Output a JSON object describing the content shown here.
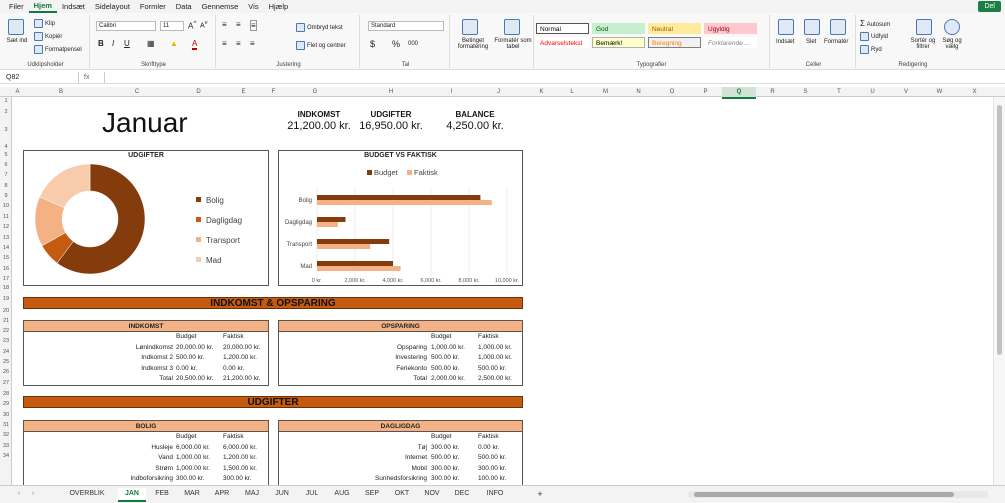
{
  "menu": {
    "items": [
      "Filer",
      "Hjem",
      "Indsæt",
      "Sidelayout",
      "Formler",
      "Data",
      "Gennemse",
      "Vis",
      "Hjælp"
    ],
    "active": "Hjem",
    "share_label": "Del"
  },
  "ribbon": {
    "clipboard": {
      "paste": "Sæt ind",
      "cut": "Klip",
      "copy": "Kopiér",
      "format_painter": "Formatpensel",
      "label": "Udklipsholder"
    },
    "font": {
      "name": "Calibri",
      "size": "11",
      "label": "Skrifttype"
    },
    "alignment": {
      "wrap": "Ombryd tekst",
      "merge": "Flet og centrer",
      "label": "Justering"
    },
    "number": {
      "format": "Standard",
      "label": "Tal"
    },
    "conditional": "Betinget formatering",
    "format_table": "Formatér som tabel",
    "styles": {
      "label": "Typografier",
      "items": [
        "Normal",
        "God",
        "Neutral",
        "Ugyldig",
        "Advarselstekst",
        "Bemærk!",
        "Beregning",
        "Forklarende ..."
      ]
    },
    "cells": {
      "insert": "Indsæt",
      "delete": "Slet",
      "format": "Formatér",
      "label": "Celler"
    },
    "editing": {
      "autosum": "Autosum",
      "fill": "Udfyld",
      "clear": "Ryd",
      "sort": "Sortér og filtrer",
      "find": "Søg og vælg",
      "label": "Redigering"
    }
  },
  "formula_bar": {
    "name_box": "Q82",
    "fx": "fx",
    "value": ""
  },
  "columns": [
    "A",
    "B",
    "C",
    "D",
    "E",
    "F",
    "G",
    "H",
    "I",
    "J",
    "K",
    "L",
    "M",
    "N",
    "O",
    "P",
    "Q",
    "R",
    "S",
    "T",
    "U",
    "V",
    "W",
    "X"
  ],
  "selected_column": "Q",
  "rows": [
    "1",
    "2",
    "3",
    "4",
    "5",
    "6",
    "7",
    "8",
    "9",
    "10",
    "11",
    "12",
    "13",
    "14",
    "15",
    "16",
    "17",
    "18",
    "19",
    "20",
    "21",
    "22",
    "23",
    "24",
    "25",
    "26",
    "27",
    "28",
    "29",
    "30",
    "31",
    "32",
    "33",
    "34"
  ],
  "sheet": {
    "title": "Januar",
    "kpis": [
      {
        "label": "INDKOMST",
        "value": "21,200.00 kr."
      },
      {
        "label": "UDGIFTER",
        "value": "16,950.00 kr."
      },
      {
        "label": "BALANCE",
        "value": "4,250.00 kr."
      }
    ],
    "udgifter_chart_title": "UDGIFTER",
    "budget_chart_title": "BUDGET VS FAKTISK",
    "section1": "INDKOMST & OPSPARING",
    "section2": "UDGIFTER",
    "indkomst": {
      "title": "INDKOMST",
      "headers": [
        "Budget",
        "Faktisk"
      ],
      "rows": [
        {
          "name": "Lønindkomst",
          "budget": "20,000.00 kr.",
          "actual": "20,000.00 kr."
        },
        {
          "name": "Indkomst 2",
          "budget": "500.00 kr.",
          "actual": "1,200.00 kr."
        },
        {
          "name": "Indkomst 3",
          "budget": "0.00 kr.",
          "actual": "0.00 kr."
        },
        {
          "name": "Total",
          "budget": "20,500.00 kr.",
          "actual": "21,200.00 kr."
        }
      ]
    },
    "opsparing": {
      "title": "OPSPARING",
      "headers": [
        "Budget",
        "Faktisk"
      ],
      "rows": [
        {
          "name": "Opsparing",
          "budget": "1,000.00 kr.",
          "actual": "1,000.00 kr."
        },
        {
          "name": "Investering",
          "budget": "500.00 kr.",
          "actual": "1,000.00 kr."
        },
        {
          "name": "Feriekonto",
          "budget": "500.00 kr.",
          "actual": "500.00 kr."
        },
        {
          "name": "Total",
          "budget": "2,000.00 kr.",
          "actual": "2,500.00 kr."
        }
      ]
    },
    "bolig": {
      "title": "BOLIG",
      "headers": [
        "Budget",
        "Faktisk"
      ],
      "rows": [
        {
          "name": "Husleje",
          "budget": "6,000.00 kr.",
          "actual": "6,000.00 kr."
        },
        {
          "name": "Vand",
          "budget": "1,000.00 kr.",
          "actual": "1,200.00 kr."
        },
        {
          "name": "Strøm",
          "budget": "1,000.00 kr.",
          "actual": "1,500.00 kr."
        },
        {
          "name": "Indboforsikring",
          "budget": "300.00 kr.",
          "actual": "300.00 kr."
        }
      ]
    },
    "dagligdag": {
      "title": "DAGLIGDAG",
      "headers": [
        "Budget",
        "Faktisk"
      ],
      "rows": [
        {
          "name": "Tøj",
          "budget": "300.00 kr.",
          "actual": "0.00 kr."
        },
        {
          "name": "Internet",
          "budget": "500.00 kr.",
          "actual": "500.00 kr."
        },
        {
          "name": "Mobil",
          "budget": "300.00 kr.",
          "actual": "300.00 kr."
        },
        {
          "name": "Sunhedsforsikring",
          "budget": "300.00 kr.",
          "actual": "100.00 kr."
        }
      ]
    }
  },
  "chart_data": [
    {
      "type": "pie",
      "title": "UDGIFTER",
      "categories": [
        "Bolig",
        "Dagligdag",
        "Transport",
        "Mad"
      ],
      "values": [
        9000,
        1000,
        2200,
        2750
      ],
      "colors": [
        "#843c0c",
        "#c55a11",
        "#f4b183",
        "#f8cbad"
      ],
      "legend": "right"
    },
    {
      "type": "bar",
      "title": "BUDGET VS FAKTISK",
      "categories": [
        "Bolig",
        "Dagligdag",
        "Transport",
        "Mad"
      ],
      "series": [
        {
          "name": "Budget",
          "values": [
            8600,
            1500,
            3800,
            4000
          ],
          "color": "#843c0c"
        },
        {
          "name": "Faktisk",
          "values": [
            9200,
            1100,
            2800,
            4400
          ],
          "color": "#f4b183"
        }
      ],
      "xticks": [
        "0 kr.",
        "2,000 kr.",
        "4,000 kr.",
        "6,000 kr.",
        "8,000 kr.",
        "10,000 kr."
      ],
      "xlim": [
        0,
        10000
      ],
      "legend": "top"
    }
  ],
  "sheet_tabs": [
    "OVERBLIK",
    "JAN",
    "FEB",
    "MAR",
    "APR",
    "MAJ",
    "JUN",
    "JUL",
    "AUG",
    "SEP",
    "OKT",
    "NOV",
    "DEC",
    "INFO"
  ],
  "active_tab": "JAN",
  "add_tab": "+"
}
